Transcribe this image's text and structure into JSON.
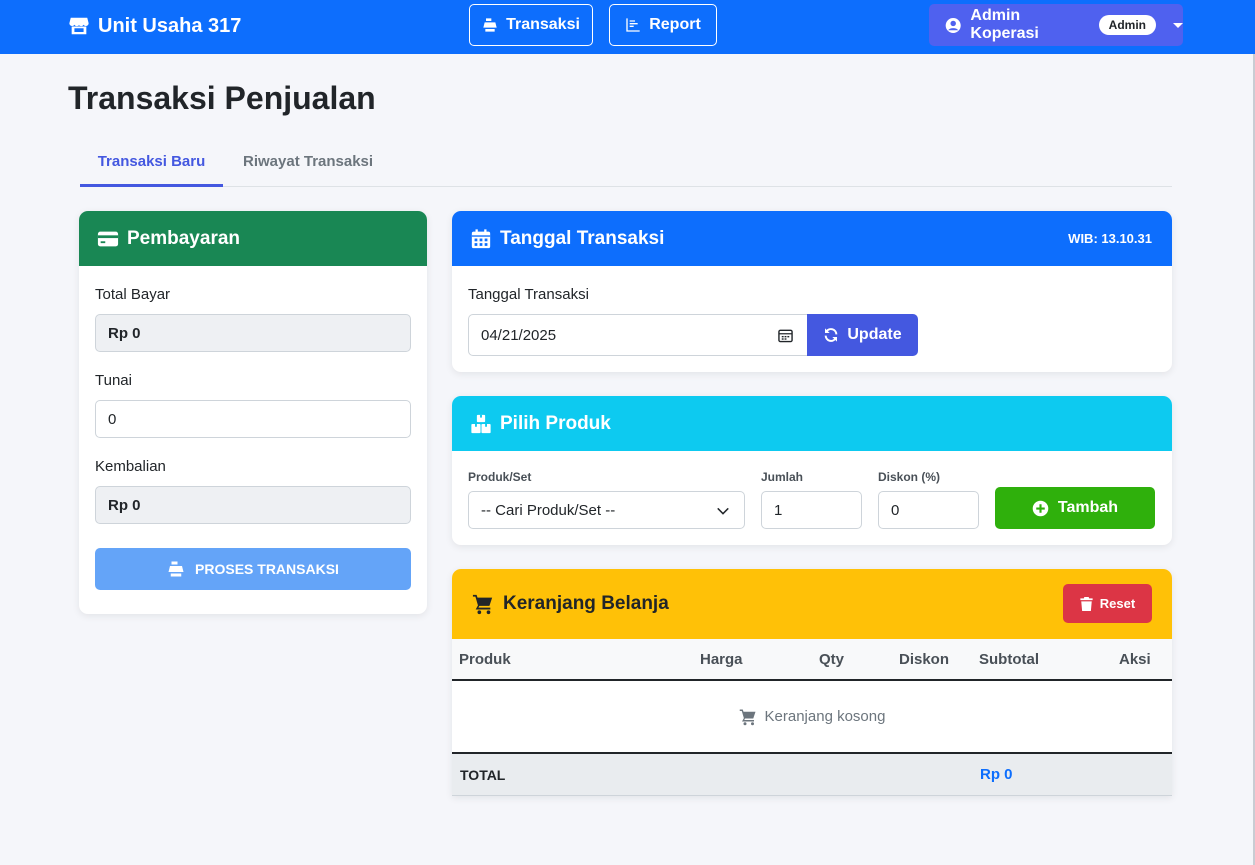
{
  "nav": {
    "brand": "Unit Usaha 317",
    "transaksi_label": "Transaksi",
    "report_label": "Report",
    "user_name": "Admin Koperasi",
    "user_role": "Admin"
  },
  "page": {
    "title": "Transaksi Penjualan",
    "tabs": [
      {
        "label": "Transaksi Baru",
        "active": true
      },
      {
        "label": "Riwayat Transaksi",
        "active": false
      }
    ]
  },
  "payment": {
    "title": "Pembayaran",
    "total_label": "Total Bayar",
    "total_value": "Rp 0",
    "tunai_label": "Tunai",
    "tunai_value": "0",
    "kembalian_label": "Kembalian",
    "kembalian_value": "Rp 0",
    "proses_label": "PROSES TRANSAKSI"
  },
  "date_card": {
    "title": "Tanggal Transaksi",
    "clock": "WIB: 13.10.31",
    "field_label": "Tanggal Transaksi",
    "date_value": "04/21/2025",
    "update_label": "Update"
  },
  "product_card": {
    "title": "Pilih Produk",
    "produk_label": "Produk/Set",
    "produk_selected": "-- Cari Produk/Set --",
    "jumlah_label": "Jumlah",
    "jumlah_value": "1",
    "diskon_label": "Diskon (%)",
    "diskon_value": "0",
    "tambah_label": "Tambah"
  },
  "cart": {
    "title": "Keranjang Belanja",
    "reset_label": "Reset",
    "columns": [
      "Produk",
      "Harga",
      "Qty",
      "Diskon",
      "Subtotal",
      "Aksi"
    ],
    "empty_text": "Keranjang kosong",
    "total_label": "TOTAL",
    "total_value": "Rp 0"
  },
  "colors": {
    "navbar": "#0d6efd",
    "payment_header": "#198754",
    "date_header": "#0d6efd",
    "product_header": "#0dcaf0",
    "cart_header": "#ffc107",
    "tambah_button": "#2fb00c",
    "reset_button": "#dc3545"
  },
  "icons": {
    "brand": "store-icon",
    "transaksi": "cash-register-icon",
    "report": "chart-icon",
    "user": "user-circle-icon",
    "payment": "credit-card-icon",
    "date": "calendar-icon",
    "product": "boxes-icon",
    "cart": "cart-icon",
    "reset": "trash-icon",
    "update": "refresh-icon",
    "tambah": "plus-circle-icon"
  }
}
